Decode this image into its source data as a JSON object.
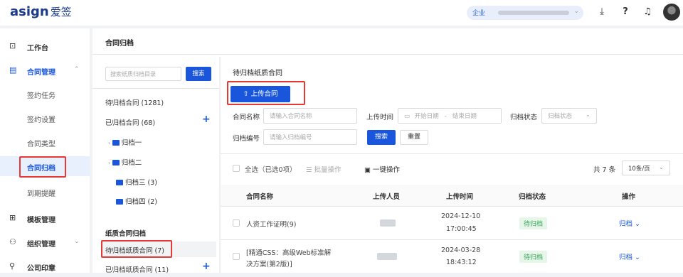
{
  "header": {
    "logo_text": "asign",
    "logo_cn": "爱签",
    "org_badge": "企业",
    "org_chevron": "⌄",
    "icons": [
      "download-icon",
      "help-icon",
      "support-icon",
      "avatar"
    ]
  },
  "sidebar": {
    "items": [
      {
        "label": "工作台",
        "icon": "monitor-icon",
        "glyph": "⊡"
      },
      {
        "label": "合同管理",
        "icon": "contract-icon",
        "glyph": "▤",
        "arrow": "⌃"
      },
      {
        "label": "模板管理",
        "icon": "template-icon",
        "glyph": "⊞"
      },
      {
        "label": "组织管理",
        "icon": "org-icon",
        "glyph": "⚇",
        "arrow": "⌄"
      },
      {
        "label": "公司印章",
        "icon": "seal-icon",
        "glyph": "⚲"
      }
    ],
    "subitems": [
      "签约任务",
      "签约设置",
      "合同类型",
      "合同归档",
      "到期提醒"
    ],
    "active_sub": "合同归档"
  },
  "breadcrumb": "合同归档",
  "left_panel": {
    "search_placeholder": "搜索纸质归档目录",
    "search_button": "搜索",
    "pending_group": "待归档合同 (1281)",
    "archived_group": "已归档合同 (68)",
    "folders": [
      "归档一",
      "归档二",
      "归档三 (3)",
      "归档四 (2)"
    ],
    "paper_section": "纸质合同归档",
    "paper_pending": "待归档纸质合同 (7)",
    "paper_archived": "已归档纸质合同 (11)",
    "plus": "+"
  },
  "right_panel": {
    "title": "待归档纸质合同",
    "upload_button": "上传合同",
    "filters": {
      "name_label": "合同名称",
      "name_placeholder": "请输入合同名称",
      "time_label": "上传时间",
      "start_placeholder": "开始日期",
      "dash": "-",
      "end_placeholder": "结束日期",
      "status_label": "归档状态",
      "status_placeholder": "归档状态",
      "number_label": "归档编号",
      "number_placeholder": "请输入归档编号",
      "search_button": "搜索",
      "reset_button": "重置"
    },
    "toolbar": {
      "select_all": "全选（已选0项）",
      "batch": "批量操作",
      "one_click": "一键操作",
      "total": "共 7 条",
      "page_size": "10条/页"
    },
    "columns": [
      "合同名称",
      "上传人员",
      "上传时间",
      "归档状态",
      "操作"
    ],
    "rows": [
      {
        "name": "人资工作证明(9)",
        "date": "2024-12-10",
        "time": "17:00:45",
        "status": "待归档",
        "action": "归档"
      },
      {
        "name_line1": "[精通CSS：高级Web标准解",
        "name_line2": "决方案(第2版)]",
        "date": "2024-03-28",
        "time": "18:43:12",
        "status": "待归档",
        "action": "归档"
      }
    ]
  },
  "colors": {
    "accent": "#1a56db",
    "highlight_box": "#e53935",
    "status_green": "#3aa45a"
  }
}
